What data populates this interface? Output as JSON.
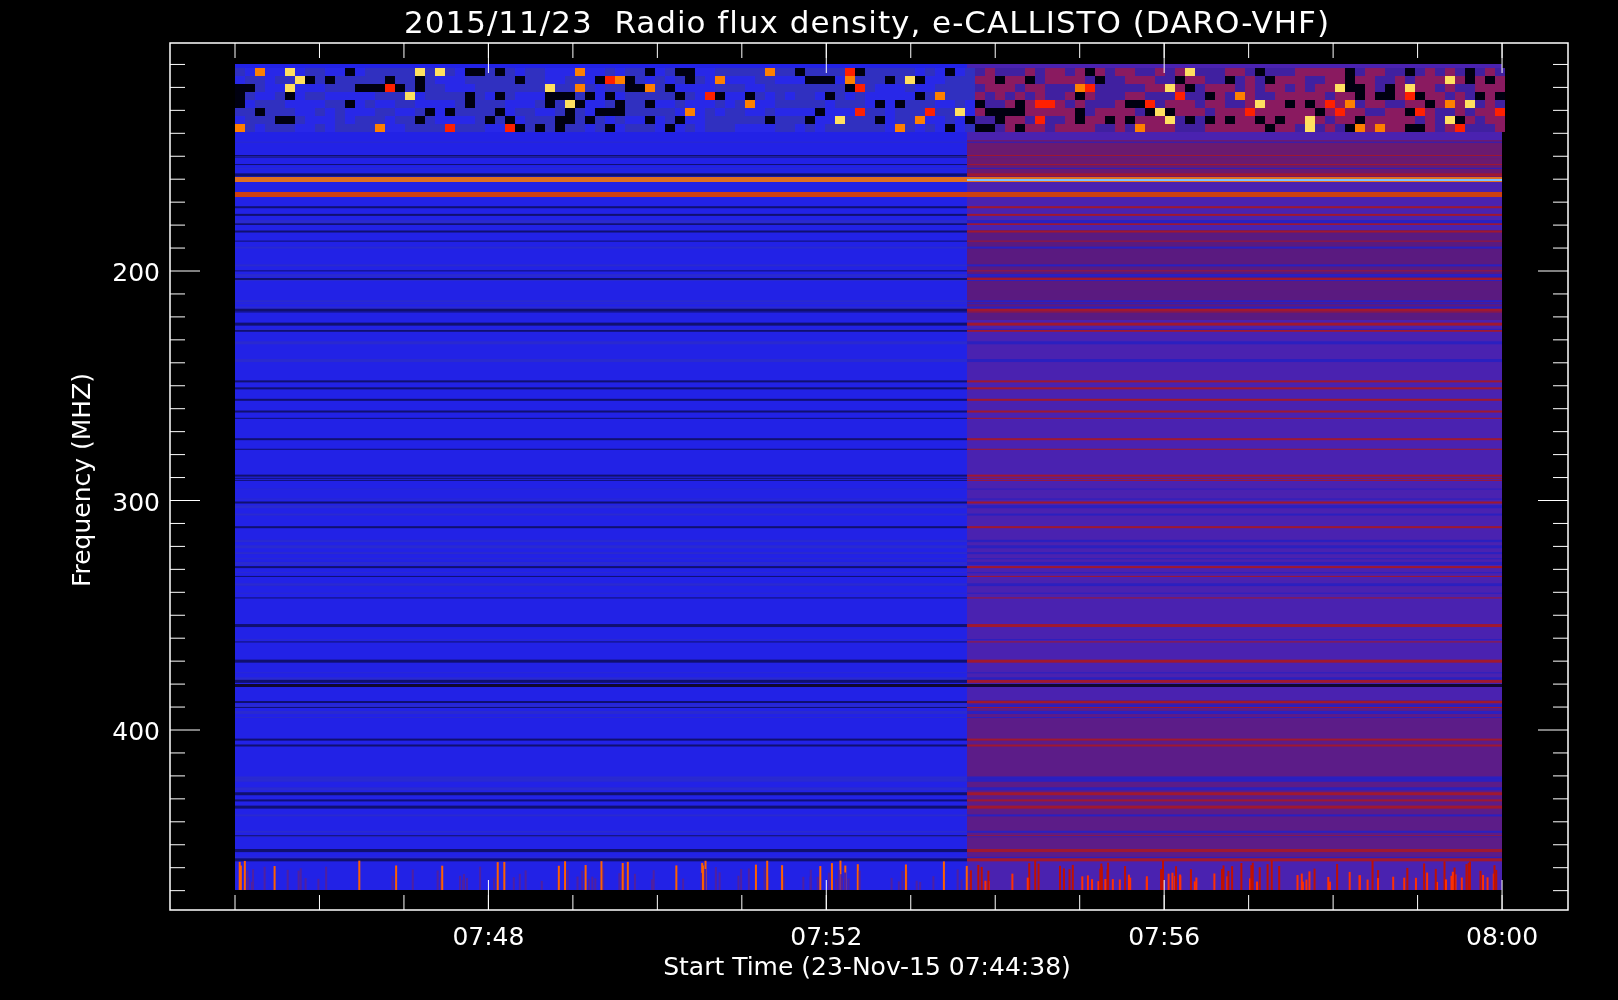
{
  "title": "2015/11/23  Radio flux density, e-CALLISTO (DARO-VHF)",
  "y_axis": {
    "label": "Frequency (MHZ)",
    "ticks": [
      "200",
      "300",
      "400"
    ]
  },
  "x_axis": {
    "label": "Start Time (23-Nov-15 07:44:38)",
    "ticks": [
      "07:48",
      "07:52",
      "07:56",
      "08:00"
    ]
  }
}
